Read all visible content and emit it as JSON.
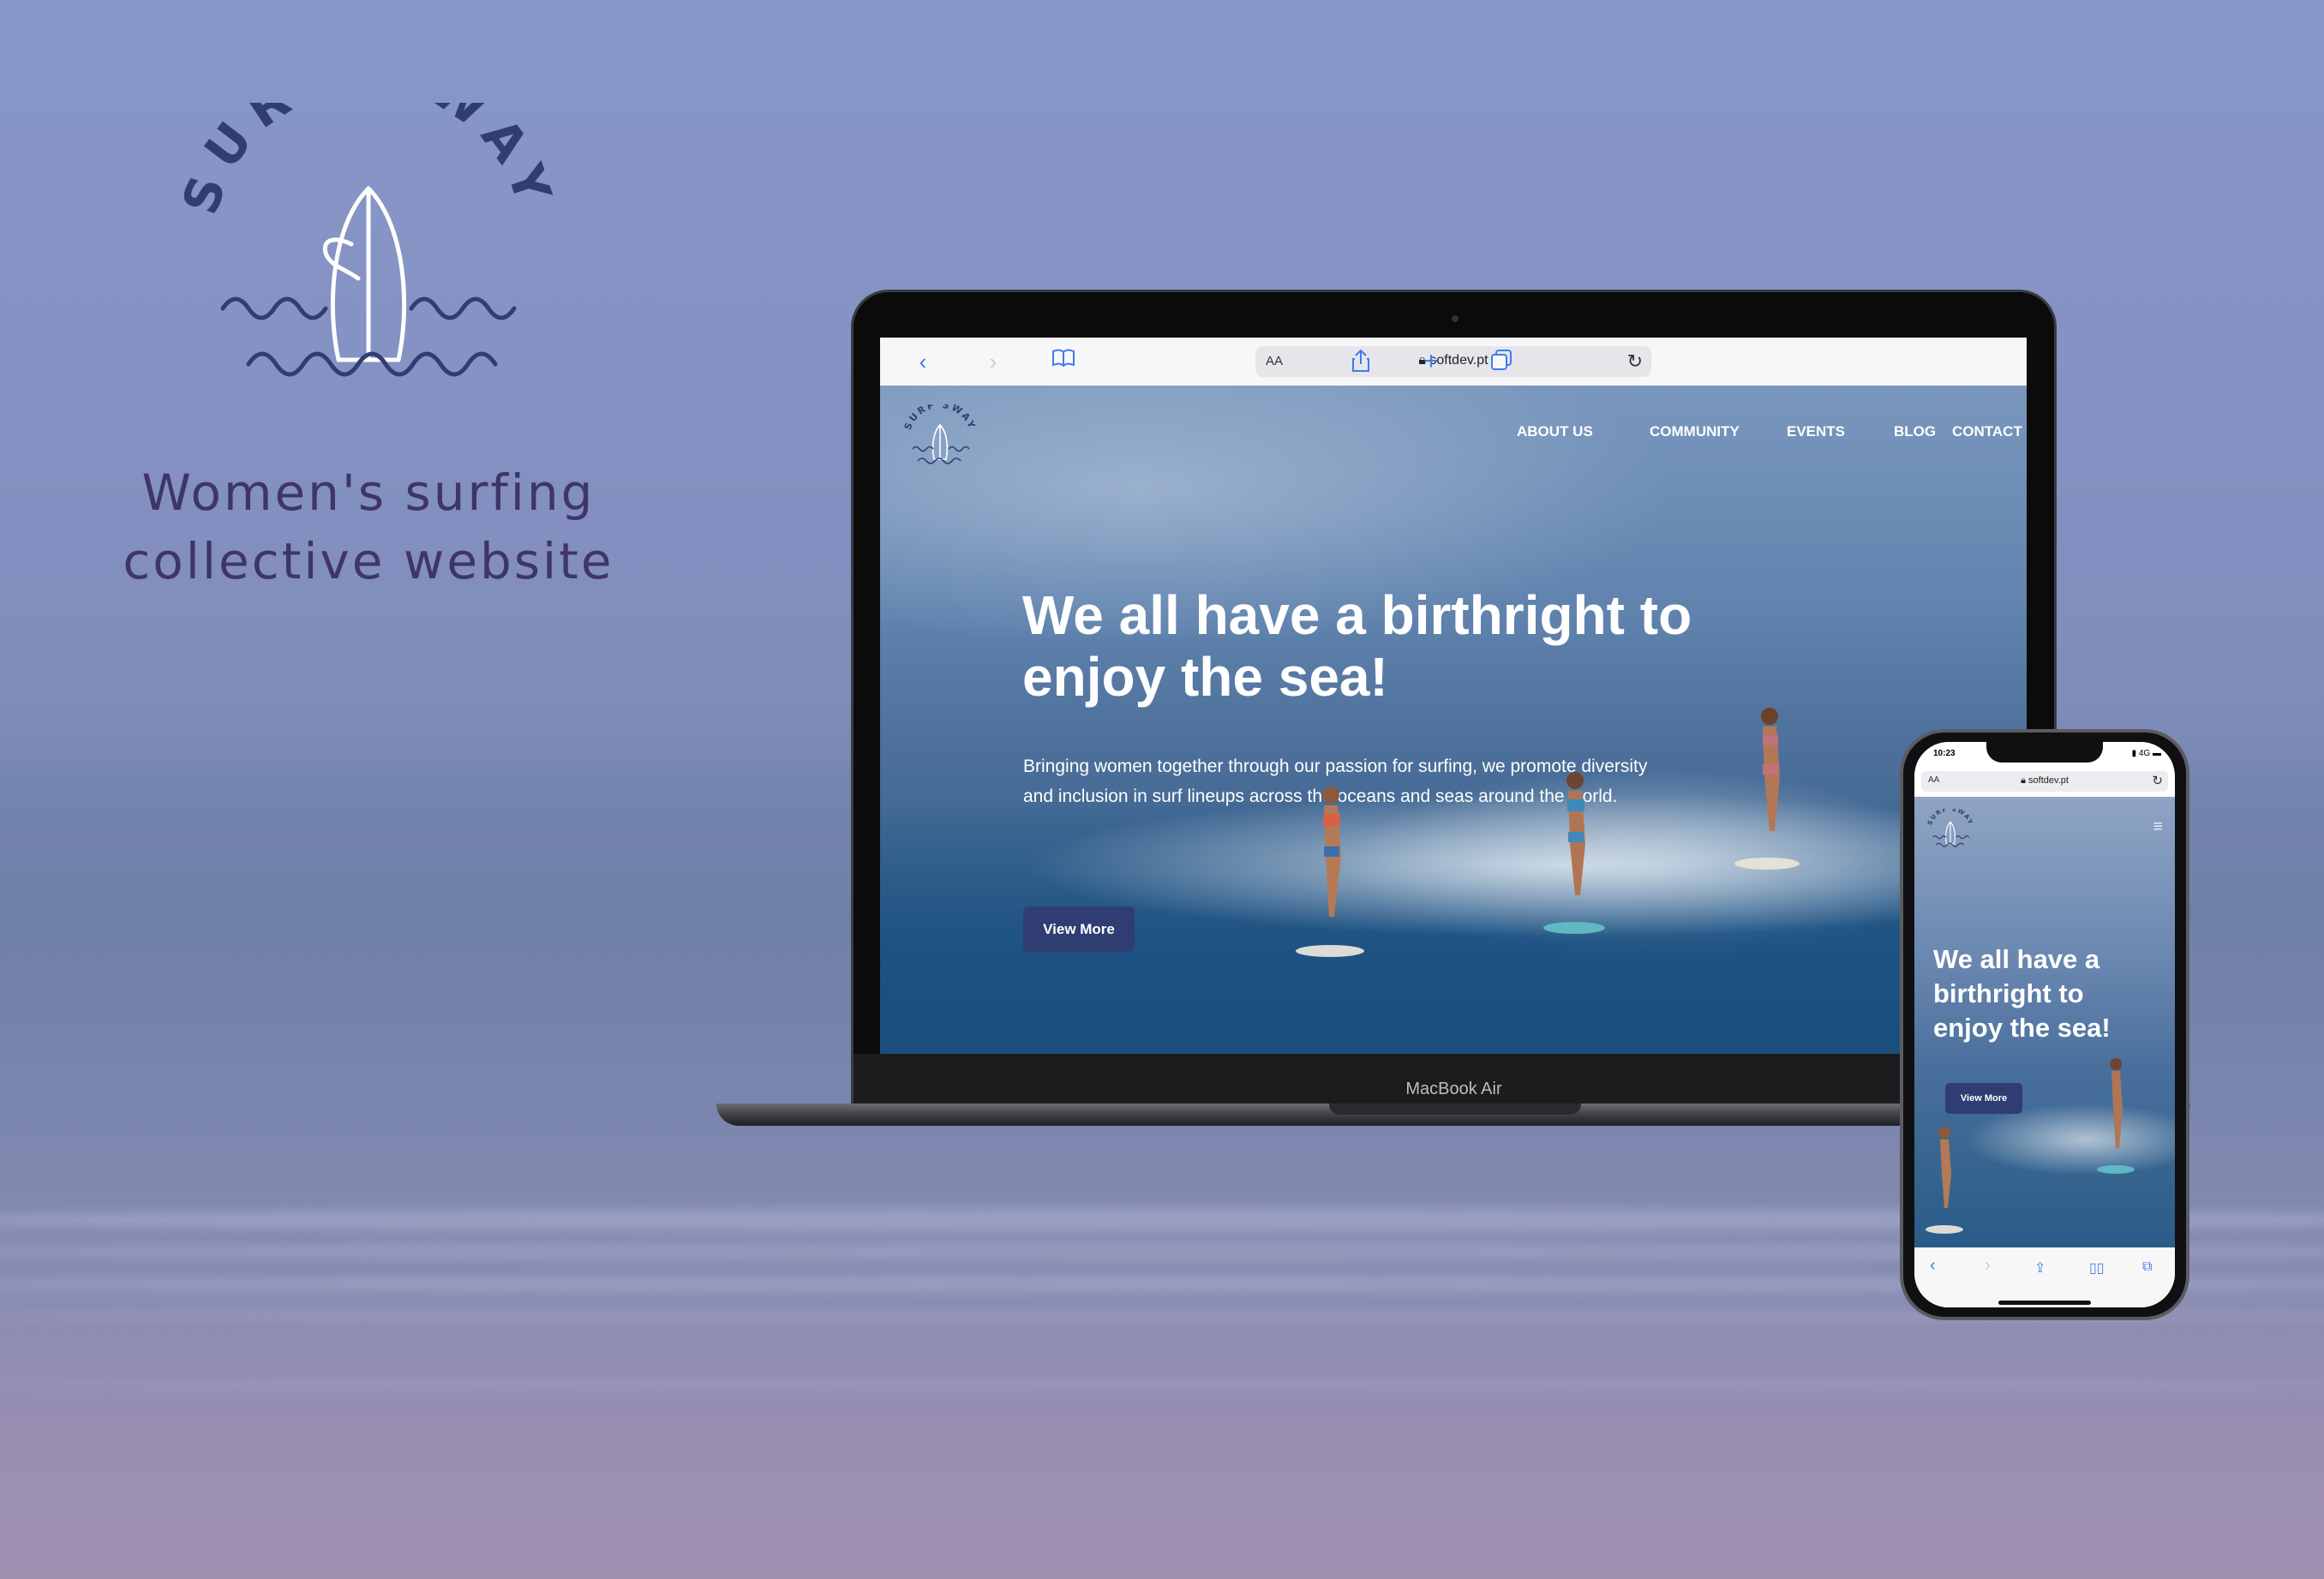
{
  "brand": {
    "logo_text": "SURF SWAY",
    "tagline_line1": "Women's surfing",
    "tagline_line2": "collective website"
  },
  "laptop": {
    "model_label": "MacBook Air",
    "browser": {
      "aa_label": "AA",
      "url": "softdev.pt",
      "icons": [
        "back-icon",
        "forward-icon",
        "bookmarks-icon",
        "lock-icon",
        "reload-icon",
        "share-icon",
        "new-tab-icon",
        "tabs-icon"
      ]
    },
    "site": {
      "logo_text": "SURF SWAY",
      "nav": [
        "ABOUT US",
        "COMMUNITY",
        "EVENTS",
        "BLOG",
        "CONTACT"
      ],
      "hero_title": "We all have a birthright to enjoy the sea!",
      "hero_text": "Bringing women together through our passion for surfing, we promote diversity and inclusion in surf lineups across the oceans and seas around the world.",
      "button_label": "View More"
    }
  },
  "phone": {
    "status": {
      "time": "10:23",
      "signal": "4G"
    },
    "browser": {
      "aa_label": "AA",
      "url": "softdev.pt"
    },
    "site": {
      "logo_text": "SURF SWAY",
      "hero_title": "We all have a birthright to enjoy the sea!",
      "button_label": "View More"
    }
  },
  "colors": {
    "brand_navy": "#2f3d72",
    "tagline": "#3f3566",
    "safari_blue": "#3f7bf0"
  }
}
